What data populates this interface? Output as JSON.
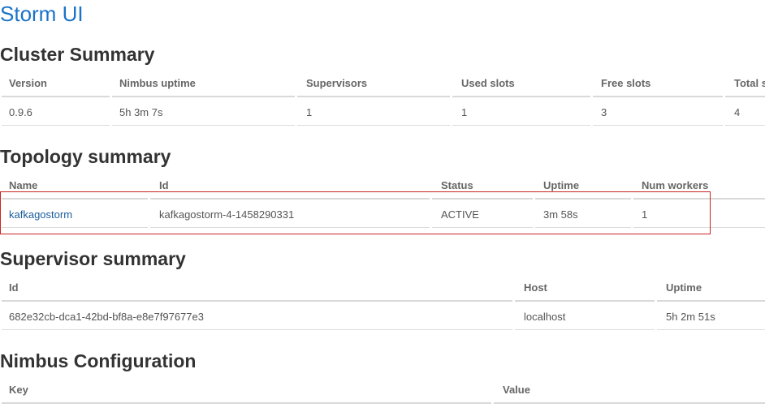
{
  "app": {
    "title": "Storm UI"
  },
  "cluster_summary": {
    "title": "Cluster Summary",
    "headers": [
      "Version",
      "Nimbus uptime",
      "Supervisors",
      "Used slots",
      "Free slots",
      "Total s"
    ],
    "row": [
      "0.9.6",
      "5h 3m 7s",
      "1",
      "1",
      "3",
      "4"
    ]
  },
  "topology_summary": {
    "title": "Topology summary",
    "headers": [
      "Name",
      "Id",
      "Status",
      "Uptime",
      "Num workers"
    ],
    "row": [
      "kafkagostorm",
      "kafkagostorm-4-1458290331",
      "ACTIVE",
      "3m 58s",
      "1"
    ]
  },
  "supervisor_summary": {
    "title": "Supervisor summary",
    "headers": [
      "Id",
      "Host",
      "Uptime"
    ],
    "row": [
      "682e32cb-dca1-42bd-bf8a-e8e7f97677e3",
      "localhost",
      "5h 2m 51s"
    ]
  },
  "nimbus_configuration": {
    "title": "Nimbus Configuration",
    "headers": [
      "Key",
      "Value"
    ]
  }
}
